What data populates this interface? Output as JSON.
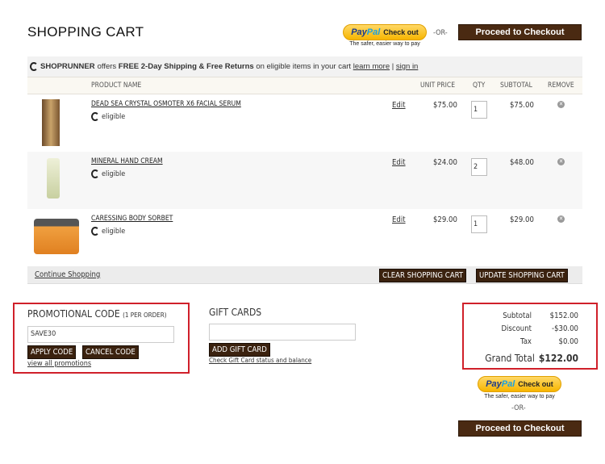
{
  "title": "SHOPPING CART",
  "paypal": {
    "pay": "Pay",
    "pal": "Pal",
    "checkout": "Check out",
    "tagline": "The safer, easier way to pay"
  },
  "or": "-OR-",
  "proceed": "Proceed to Checkout",
  "shoprunner": {
    "brand": "SHOPRUNNER",
    "t1": "offers",
    "bold": "FREE 2-Day Shipping & Free Returns",
    "t2": "on eligible items in your cart",
    "learn": "learn more",
    "sep": "|",
    "sign": "sign in"
  },
  "headers": {
    "product": "PRODUCT NAME",
    "unit": "UNIT PRICE",
    "qty": "QTY",
    "subtotal": "SUBTOTAL",
    "remove": "REMOVE"
  },
  "items": [
    {
      "name": "DEAD SEA CRYSTAL OSMOTER X6 FACIAL SERUM",
      "eligible": "eligible",
      "edit": "Edit",
      "price": "$75.00",
      "qty": "1",
      "subtotal": "$75.00"
    },
    {
      "name": "MINERAL HAND CREAM",
      "eligible": "eligible",
      "edit": "Edit",
      "price": "$24.00",
      "qty": "2",
      "subtotal": "$48.00"
    },
    {
      "name": "CARESSING BODY SORBET",
      "eligible": "eligible",
      "edit": "Edit",
      "price": "$29.00",
      "qty": "1",
      "subtotal": "$29.00"
    }
  ],
  "continue": "Continue Shopping",
  "clear": "CLEAR SHOPPING CART",
  "update": "UPDATE SHOPPING CART",
  "promo": {
    "title": "PROMOTIONAL CODE",
    "note": "(1 PER ORDER)",
    "value": "SAVE30",
    "apply": "APPLY CODE",
    "cancel": "CANCEL CODE",
    "view": "view all promotions"
  },
  "gift": {
    "title": "GIFT CARDS",
    "value": "",
    "add": "ADD GIFT CARD",
    "check": "Check Gift Card status and balance"
  },
  "totals": {
    "subtotal_label": "Subtotal",
    "subtotal": "$152.00",
    "discount_label": "Discount",
    "discount": "-$30.00",
    "tax_label": "Tax",
    "tax": "$0.00",
    "grand_label": "Grand Total",
    "grand": "$122.00"
  }
}
